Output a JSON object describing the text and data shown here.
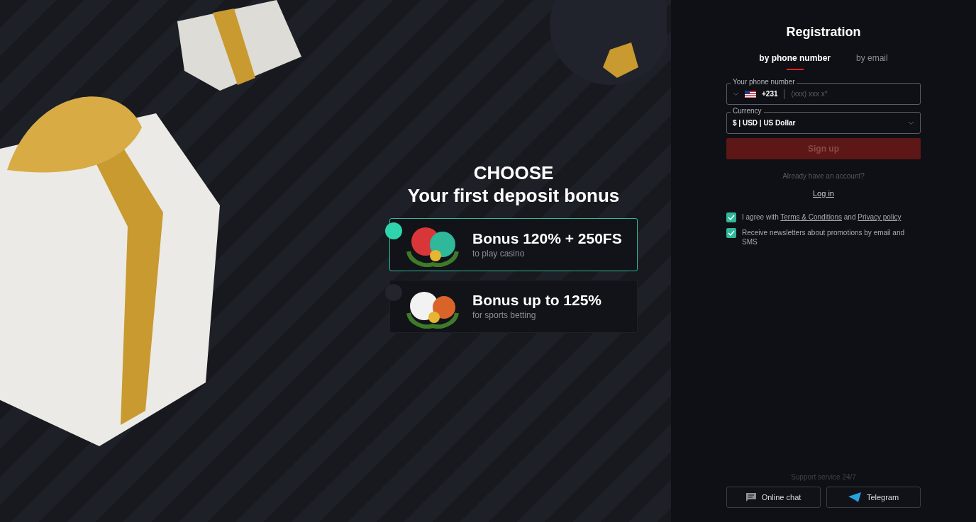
{
  "promo": {
    "heading": "CHOOSE",
    "subheading": "Your first deposit bonus",
    "bonuses": [
      {
        "kind": "casino",
        "title": "Bonus 120% + 250FS",
        "subtitle": "to play casino",
        "selected": true
      },
      {
        "kind": "sports",
        "title": "Bonus up to 125%",
        "subtitle": "for sports betting",
        "selected": false
      }
    ]
  },
  "registration": {
    "title": "Registration",
    "tabs": [
      {
        "label": "by phone number",
        "selected": true
      },
      {
        "label": "by email",
        "selected": false
      }
    ],
    "phone": {
      "label": "Your phone number",
      "code": "+231",
      "placeholder": "(xxx) xxx x*"
    },
    "currency": {
      "label": "Currency",
      "value": "$ | USD | US Dollar"
    },
    "submit": {
      "label": "Sign up",
      "disabled": true
    },
    "account_prompt": "Already have an account?",
    "login": "Log in",
    "consents": [
      {
        "parts": [
          "I agree with ",
          "Terms & Conditions",
          " and ",
          "Privacy policy"
        ],
        "checked": true
      },
      {
        "parts": [
          "Receive newsletters about promotions by email and SMS"
        ],
        "checked": true
      }
    ],
    "support": {
      "label": "Support service 24/7",
      "buttons": [
        {
          "kind": "chat",
          "label": "Online chat"
        },
        {
          "kind": "telegram",
          "label": "Telegram"
        }
      ]
    }
  }
}
